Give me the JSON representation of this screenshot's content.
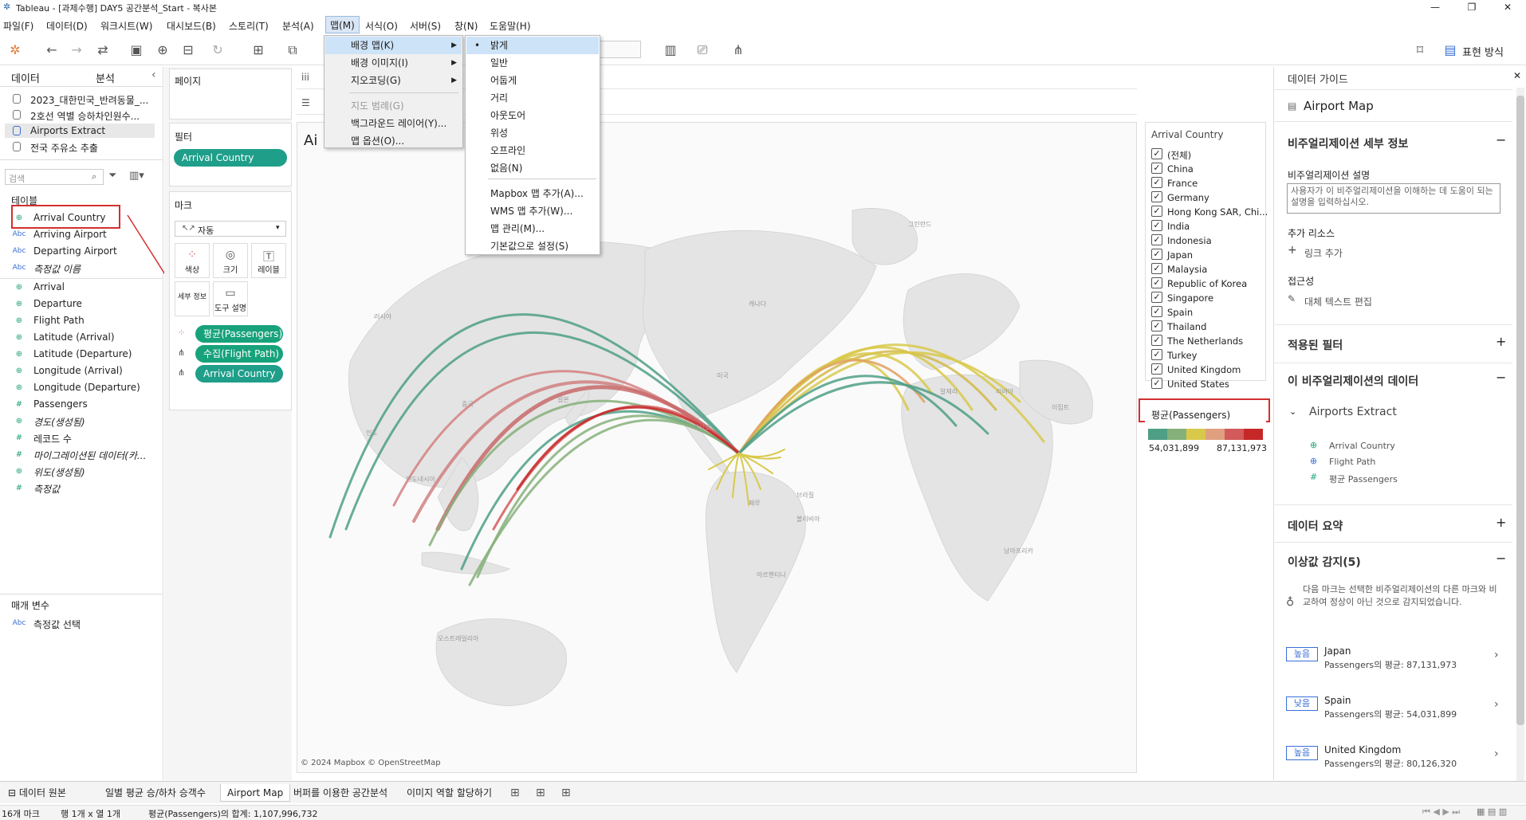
{
  "window": {
    "title": "Tableau - [과제수행] DAY5 공간분석_Start - 복사본",
    "min": "—",
    "max": "❐",
    "close": "✕"
  },
  "menus": [
    "파일(F)",
    "데이터(D)",
    "워크시트(W)",
    "대시보드(B)",
    "스토리(T)",
    "분석(A)",
    "맵(M)",
    "서식(O)",
    "서버(S)",
    "창(N)",
    "도움말(H)"
  ],
  "toolbar": {
    "show_me": "표현 방식"
  },
  "data_pane": {
    "tab_data": "데이터",
    "tab_analysis": "분석",
    "datasources": [
      "2023_대한민국_반려동물_...",
      "2호선 역별 승하차인원수...",
      "Airports Extract",
      "전국 주유소 추출"
    ],
    "search_placeholder": "검색",
    "tables_label": "테이블",
    "fields": [
      {
        "name": "Arrival Country",
        "icon": "globe"
      },
      {
        "name": "Arriving Airport",
        "icon": "abc"
      },
      {
        "name": "Departing Airport",
        "icon": "abc"
      },
      {
        "name": "측정값 이름",
        "icon": "abc",
        "italic": true
      },
      {
        "name": "Arrival",
        "icon": "globe"
      },
      {
        "name": "Departure",
        "icon": "globe"
      },
      {
        "name": "Flight Path",
        "icon": "globe"
      },
      {
        "name": "Latitude (Arrival)",
        "icon": "globe"
      },
      {
        "name": "Latitude (Departure)",
        "icon": "globe"
      },
      {
        "name": "Longitude (Arrival)",
        "icon": "globe"
      },
      {
        "name": "Longitude (Departure)",
        "icon": "globe"
      },
      {
        "name": "Passengers",
        "icon": "hash"
      },
      {
        "name": "경도(생성됨)",
        "icon": "globe",
        "italic": true
      },
      {
        "name": "레코드 수",
        "icon": "hash"
      },
      {
        "name": "마이그레이션된 데이터(카...",
        "icon": "hash",
        "italic": true
      },
      {
        "name": "위도(생성됨)",
        "icon": "globe",
        "italic": true
      },
      {
        "name": "측정값",
        "icon": "hash",
        "italic": true
      }
    ],
    "params_label": "매개 변수",
    "param": "측정값 선택"
  },
  "shelves": {
    "pages": "페이지",
    "filters": "필터",
    "filter_pill": "Arrival Country",
    "marks": "마크",
    "mark_type": "자동",
    "btn_color": "색상",
    "btn_size": "크기",
    "btn_label": "레이블",
    "btn_detail": "세부 정보",
    "btn_tooltip": "도구 설명",
    "pill_color": "평균(Passengers)",
    "pill_path": "수집(Flight Path)",
    "pill_detail": "Arrival Country"
  },
  "map": {
    "title": "Ai",
    "attribution": "© 2024 Mapbox © OpenStreetMap",
    "labels": [
      "러시아",
      "중국",
      "인도",
      "인도네시아",
      "일본",
      "미국",
      "캐나다",
      "멕시코",
      "브라질",
      "볼리비아",
      "페루",
      "아르헨티나",
      "오스트레일리아",
      "알제리",
      "리비아",
      "이집트",
      "남아프리카",
      "그린란드"
    ]
  },
  "filter_card": {
    "title": "Arrival Country",
    "items": [
      "(전체)",
      "China",
      "France",
      "Germany",
      "Hong Kong SAR, Chi...",
      "India",
      "Indonesia",
      "Japan",
      "Malaysia",
      "Republic of Korea",
      "Singapore",
      "Spain",
      "Thailand",
      "The Netherlands",
      "Turkey",
      "United Kingdom",
      "United States"
    ]
  },
  "legend": {
    "title": "평균(Passengers)",
    "min": "54,031,899",
    "max": "87,131,973",
    "colors": [
      "#4e9f86",
      "#86b07a",
      "#d8c94a",
      "#e0a080",
      "#d25a5a",
      "#c62828"
    ]
  },
  "map_menu": {
    "items": [
      {
        "label": "배경 맵(K)",
        "arrow": true,
        "active": true
      },
      {
        "label": "배경 이미지(I)",
        "arrow": true
      },
      {
        "label": "지오코딩(G)",
        "arrow": true
      },
      {
        "label": "지도 범례(G)",
        "disabled": true
      },
      {
        "label": "백그라운드 레이어(Y)..."
      },
      {
        "label": "맵 옵션(O)..."
      }
    ]
  },
  "bg_submenu": {
    "items": [
      "밝게",
      "일반",
      "어둡게",
      "거리",
      "아웃도어",
      "위성",
      "오프라인",
      "없음(N)",
      "Mapbox 맵 추가(A)...",
      "WMS 맵 추가(W)...",
      "맵 관리(M)...",
      "기본값으로 설정(S)"
    ],
    "checked": "•"
  },
  "guide": {
    "header": "데이터 가이드",
    "viz_name": "Airport Map",
    "details_title": "비주얼리제이션 세부 정보",
    "desc_label": "비주얼리제이션 설명",
    "desc_placeholder": "사용자가 이 비주얼리제이션을 이해하는 데 도움이 되는 설명을 입력하십시오.",
    "resources_label": "추가 리소스",
    "add_link": "링크 추가",
    "access_label": "접근성",
    "alt_text": "대체 텍스트 편집",
    "filters_title": "적용된 필터",
    "data_title": "이 비주얼리제이션의 데이터",
    "source": "Airports Extract",
    "source_fields": [
      "Arrival Country",
      "Flight Path",
      "평균 Passengers"
    ],
    "summary_title": "데이터 요약",
    "outlier_title": "이상값 감지(5)",
    "outlier_desc": "다음 마크는 선택한 비주얼리제이션의 다른 마크와 비교하여 정상이 아닌 것으로 감지되었습니다.",
    "outliers": [
      {
        "tag": "높음",
        "name": "Japan",
        "value": "Passengers의 평균: 87,131,973"
      },
      {
        "tag": "낮음",
        "name": "Spain",
        "value": "Passengers의 평균: 54,031,899"
      },
      {
        "tag": "높음",
        "name": "United Kingdom",
        "value": "Passengers의 평균: 80,126,320"
      }
    ]
  },
  "sheet_tabs": [
    "데이터 원본",
    "일별 평균 승/하차 승객수",
    "Airport Map",
    "버퍼를 이용한 공간분석",
    "이미지 역할 할당하기"
  ],
  "status": {
    "marks": "16개 마크",
    "rows": "행 1개 x 열 1개",
    "sum": "평균(Passengers)의 합계: 1,107,996,732"
  }
}
